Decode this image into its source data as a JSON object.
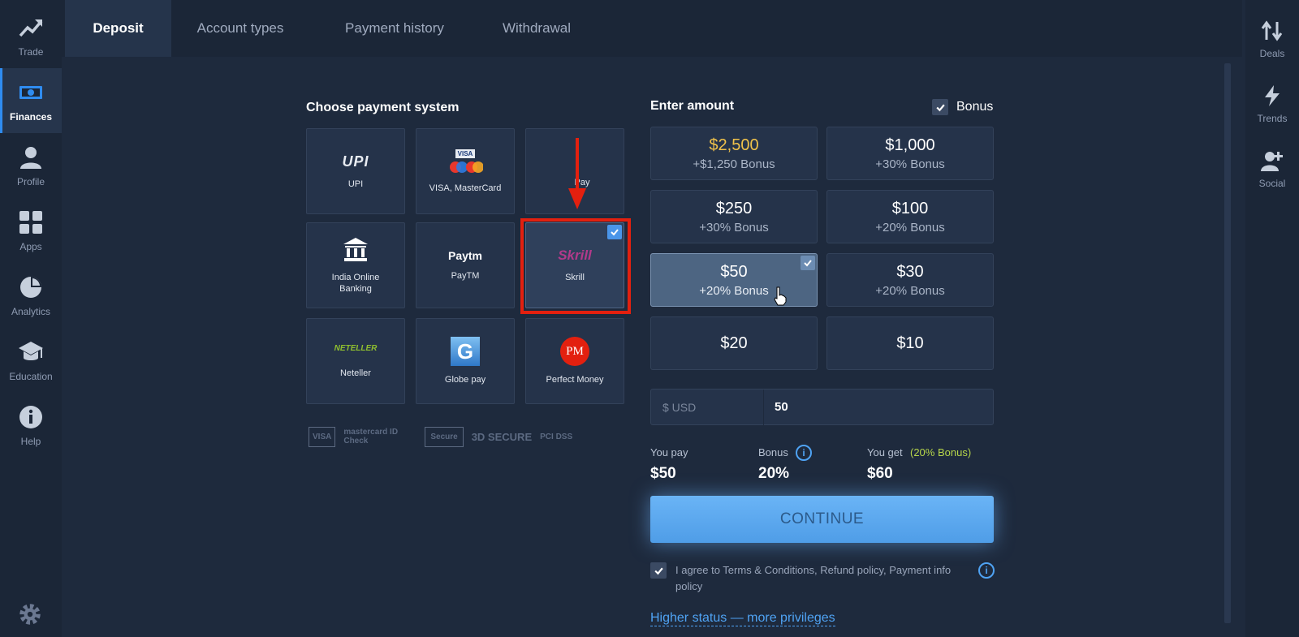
{
  "left_nav": {
    "items": [
      {
        "label": "Trade",
        "icon": "trend-up-icon"
      },
      {
        "label": "Finances",
        "icon": "money-icon",
        "active": true
      },
      {
        "label": "Profile",
        "icon": "user-icon"
      },
      {
        "label": "Apps",
        "icon": "apps-grid-icon"
      },
      {
        "label": "Analytics",
        "icon": "pie-chart-icon"
      },
      {
        "label": "Education",
        "icon": "graduation-cap-icon"
      },
      {
        "label": "Help",
        "icon": "info-icon"
      }
    ],
    "settings_icon": "gear-icon"
  },
  "right_nav": {
    "items": [
      {
        "label": "Deals",
        "icon": "arrows-updown-icon"
      },
      {
        "label": "Trends",
        "icon": "lightning-icon"
      },
      {
        "label": "Social",
        "icon": "add-user-icon"
      }
    ]
  },
  "tabs": [
    "Deposit",
    "Account types",
    "Payment history",
    "Withdrawal"
  ],
  "payment": {
    "title": "Choose payment system",
    "methods": [
      {
        "label": "UPI",
        "logo": "UPI"
      },
      {
        "label": "VISA, MasterCard",
        "logo": "VISA"
      },
      {
        "label": "Pay",
        "logo": ""
      },
      {
        "label": "India Online Banking",
        "logo": ""
      },
      {
        "label": "PayTM",
        "logo": "Paytm"
      },
      {
        "label": "Skrill",
        "logo": "Skrill",
        "selected": true
      },
      {
        "label": "Neteller",
        "logo": "NETELLER"
      },
      {
        "label": "Globe pay",
        "logo": "G"
      },
      {
        "label": "Perfect Money",
        "logo": "PM"
      }
    ],
    "trust_logos": [
      "VISA",
      "mastercard ID Check",
      "Secure",
      "3D SECURE",
      "PCI DSS"
    ]
  },
  "amount": {
    "title": "Enter amount",
    "bonus_label": "Bonus",
    "options": [
      {
        "amount": "$2,500",
        "bonus": "+$1,250 Bonus",
        "gold": true
      },
      {
        "amount": "$1,000",
        "bonus": "+30% Bonus"
      },
      {
        "amount": "$250",
        "bonus": "+30% Bonus"
      },
      {
        "amount": "$100",
        "bonus": "+20% Bonus"
      },
      {
        "amount": "$50",
        "bonus": "+20% Bonus",
        "selected": true
      },
      {
        "amount": "$30",
        "bonus": "+20% Bonus"
      },
      {
        "amount": "$20",
        "bonus": ""
      },
      {
        "amount": "$10",
        "bonus": ""
      }
    ],
    "currency_label": "$ USD",
    "input_value": "50"
  },
  "summary": {
    "you_pay_label": "You pay",
    "you_pay_value": "$50",
    "bonus_label": "Bonus",
    "bonus_value": "20%",
    "you_get_label": "You get",
    "you_get_note": "(20% Bonus)",
    "you_get_value": "$60"
  },
  "continue_label": "CONTINUE",
  "agree_text": "I agree to Terms & Conditions, Refund policy, Payment info policy",
  "higher_status_link": "Higher status — more privileges",
  "colors": {
    "background": "#1e2a3d",
    "accent": "#4fa3f4",
    "highlight_red": "#e3200f",
    "gold": "#f0c24a",
    "bonus_green": "#b5d44a"
  }
}
